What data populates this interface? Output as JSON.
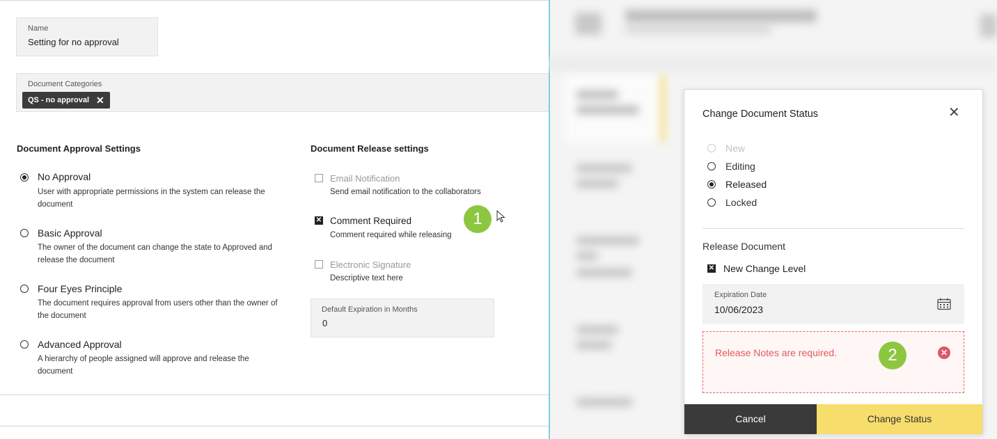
{
  "name_field": {
    "label": "Name",
    "value": "Setting for no approval"
  },
  "categories_field": {
    "label": "Document Categories",
    "chip_label": "QS - no approval",
    "chip_remove": "✕"
  },
  "approval": {
    "title": "Document Approval Settings",
    "options": [
      {
        "title": "No Approval",
        "desc1": "User with appropriate permissions in the system can release the",
        "desc2": "document",
        "selected": true
      },
      {
        "title": "Basic Approval",
        "desc1": "The owner of the document can change the state to Approved and",
        "desc2": "release the document",
        "selected": false
      },
      {
        "title": "Four Eyes Principle",
        "desc1": "The document requires approval from users other than the owner of",
        "desc2": "the document",
        "selected": false
      },
      {
        "title": "Advanced Approval",
        "desc1": "A hierarchy of people assigned will approve and release the",
        "desc2": "document",
        "selected": false
      }
    ]
  },
  "release": {
    "title": "Document Release settings",
    "options": [
      {
        "title": "Email Notification",
        "desc": "Send email notification to the collaborators",
        "checked": false,
        "disabled": true
      },
      {
        "title": "Comment Required",
        "desc": "Comment required while releasing",
        "checked": true,
        "disabled": false
      },
      {
        "title": "Electronic Signature",
        "desc": "Descriptive text here",
        "checked": false,
        "disabled": true
      }
    ],
    "expiration": {
      "label": "Default Expiration in Months",
      "value": "0"
    }
  },
  "badges": {
    "one": "1",
    "two": "2"
  },
  "modal": {
    "title": "Change Document Status",
    "close_icon": "✕",
    "statuses": [
      {
        "label": "New",
        "selected": false,
        "disabled": true
      },
      {
        "label": "Editing",
        "selected": false,
        "disabled": false
      },
      {
        "label": "Released",
        "selected": true,
        "disabled": false
      },
      {
        "label": "Locked",
        "selected": false,
        "disabled": false
      }
    ],
    "release_section": "Release Document",
    "new_change_level": "New Change Level",
    "expiration": {
      "label": "Expiration Date",
      "value": "10/06/2023"
    },
    "error": "Release Notes are required.",
    "cancel": "Cancel",
    "change_status": "Change Status"
  },
  "colors": {
    "badge": "#8dc63f",
    "primary_button": "#f7dd6b",
    "error": "#e25b5b",
    "dark": "#3a3a3a"
  }
}
